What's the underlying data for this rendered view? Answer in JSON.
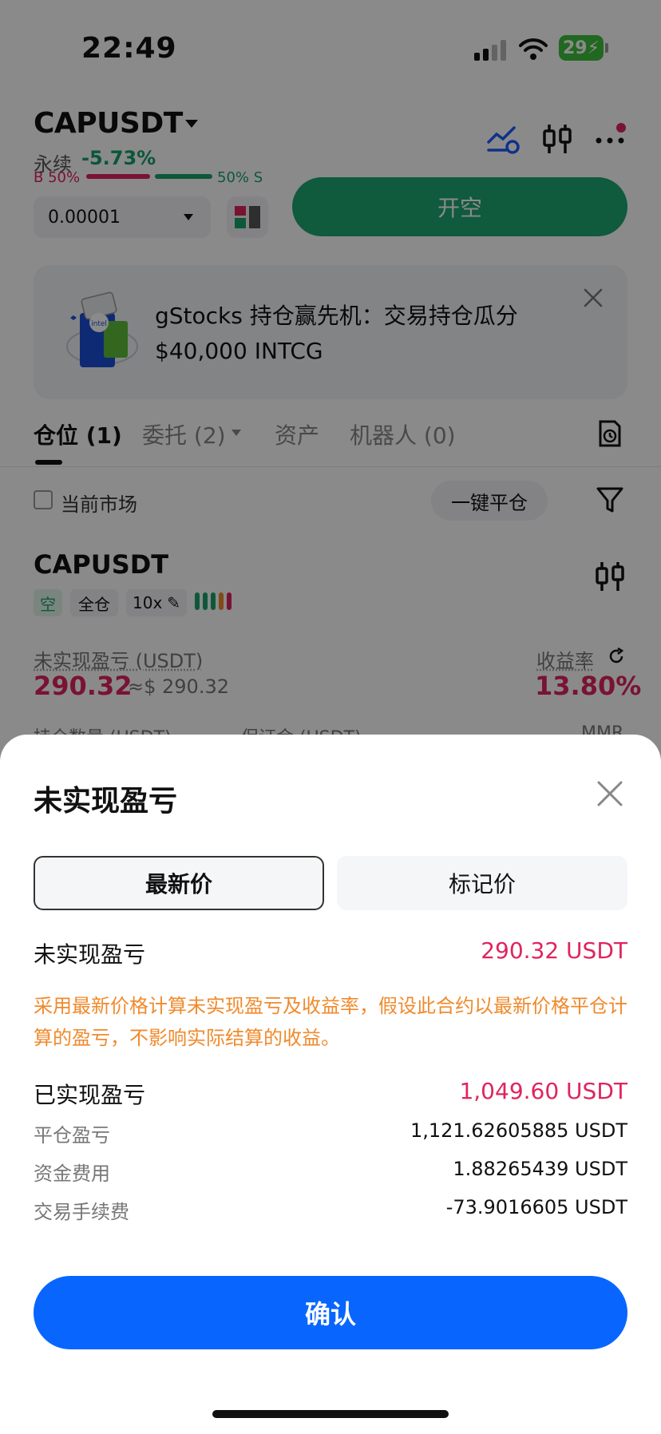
{
  "status_bar": {
    "time": "22:49",
    "battery": "29"
  },
  "header": {
    "pair": "CAPUSDT",
    "perp_label": "永续",
    "change": "-5.73%",
    "buy_ratio": "B 50%",
    "sell_ratio": "50% S",
    "buy_ratio_value": 0.5,
    "precision": "0.00001",
    "open_short_label": "开空",
    "colors": {
      "buy": "#e0245e",
      "sell": "#1aa36b",
      "accent": "#0866ff"
    }
  },
  "banner": {
    "line1": "gStocks 持仓赢先机：交易持仓瓜分",
    "line2": "$40,000 INTCG",
    "logo_text": "intel"
  },
  "tabs": [
    {
      "label": "仓位 (1)"
    },
    {
      "label": "委托 (2)"
    },
    {
      "label": "资产"
    },
    {
      "label": "机器人 (0)"
    }
  ],
  "filters": {
    "current_market_label": "当前市场",
    "close_all_label": "一键平仓"
  },
  "position": {
    "symbol": "CAPUSDT",
    "side_tag": "空",
    "margin_mode": "全仓",
    "leverage": "10x",
    "unrealized_label": "未实现盈亏 (USDT)",
    "unrealized_value": "290.32",
    "unrealized_approx": "≈$ 290.32",
    "roe_label": "收益率",
    "roe_value": "13.80%",
    "peek_labels": [
      "持仓数量 (USDT)",
      "保证金 (USDT)",
      "MMR"
    ]
  },
  "sheet": {
    "title": "未实现盈亏",
    "seg_latest": "最新价",
    "seg_mark": "标记价",
    "unrealized_label": "未实现盈亏",
    "unrealized_value": "290.32 USDT",
    "note": "采用最新价格计算未实现盈亏及收益率，假设此合约以最新价格平仓计算的盈亏，不影响实际结算的收益。",
    "realized_label": "已实现盈亏",
    "realized_value": "1,049.60 USDT",
    "details": [
      {
        "label": "平仓盈亏",
        "value": "1,121.62605885 USDT"
      },
      {
        "label": "资金费用",
        "value": "1.88265439 USDT"
      },
      {
        "label": "交易手续费",
        "value": "-73.9016605 USDT"
      }
    ],
    "confirm_label": "确认"
  }
}
